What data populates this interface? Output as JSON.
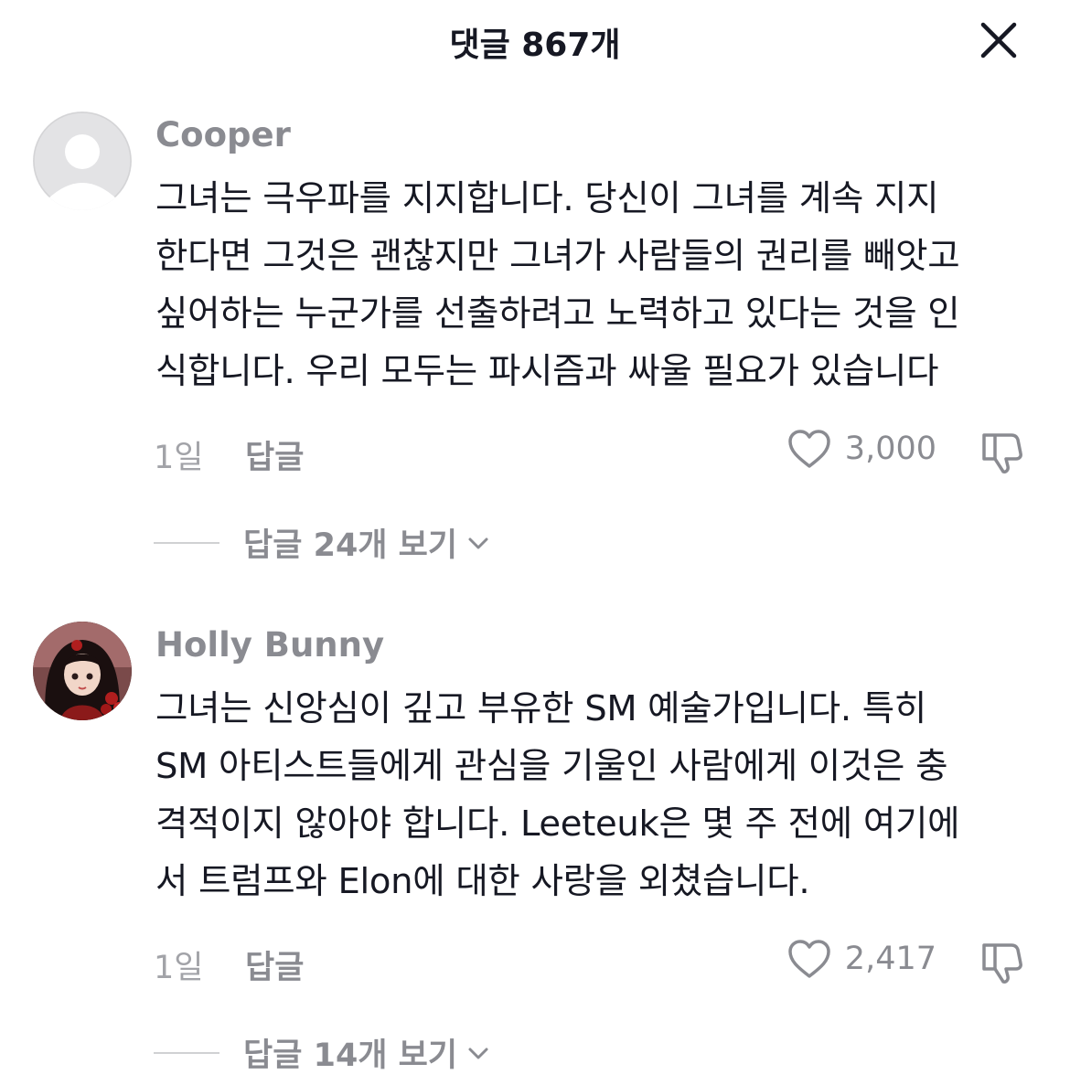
{
  "header": {
    "title": "댓글 867개",
    "close_icon": "close-icon"
  },
  "comments": [
    {
      "username": "Cooper",
      "avatar": "default-avatar",
      "lines": [
        "그녀는 극우파를 지지합니다. 당신이 그녀를 계속 지지",
        "한다면 그것은 괜찮지만 그녀가 사람들의 권리를 빼앗고",
        "싶어하는 누군가를 선출하려고 노력하고 있다는 것을 인",
        "식합니다. 우리 모두는 파시즘과 싸울 필요가 있습니다"
      ],
      "time": "1일",
      "reply_label": "답글",
      "likes": "3,000",
      "view_replies": "답글 24개 보기"
    },
    {
      "username": "Holly Bunny",
      "avatar": "illustrated-girl-avatar",
      "lines": [
        "그녀는 신앙심이 깊고 부유한 SM 예술가입니다. 특히",
        "SM 아티스트들에게 관심을 기울인 사람에게 이것은 충",
        "격적이지 않아야 합니다. Leeteuk은 몇 주 전에 여기에",
        "서 트럼프와 Elon에 대한 사랑을 외쳤습니다."
      ],
      "time": "1일",
      "reply_label": "답글",
      "likes": "2,417",
      "view_replies": "답글 14개 보기"
    }
  ],
  "colors": {
    "text_primary": "#161823",
    "text_secondary": "#8a8b91",
    "text_tertiary": "#a2a3a8",
    "divider": "#d0d1d3"
  }
}
